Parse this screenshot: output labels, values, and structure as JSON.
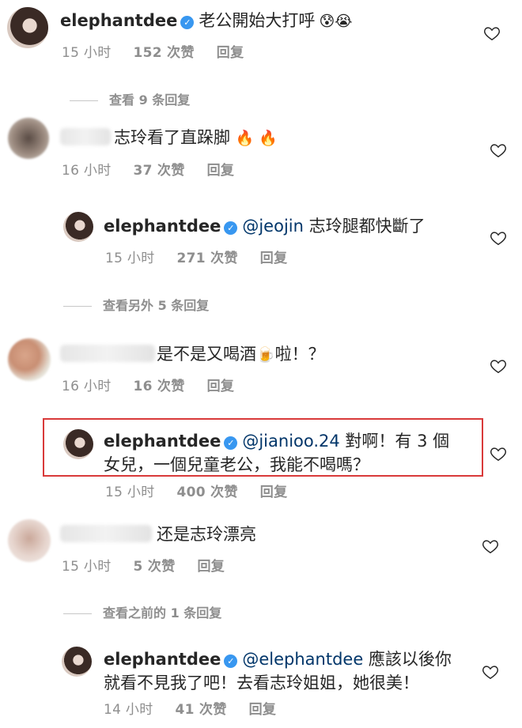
{
  "comments": [
    {
      "username": "elephantdee",
      "text": "老公開始大打呼",
      "emoji": "😰😭",
      "time": "15 小时",
      "likes": "152 次赞",
      "reply": "回复"
    },
    {
      "view_replies": "查看 9 条回复"
    },
    {
      "text": "志玲看了直跺脚",
      "emoji": "🔥 🔥",
      "time": "16 小时",
      "likes": "37 次赞",
      "reply": "回复"
    },
    {
      "username": "elephantdee",
      "mention": "@jeojin",
      "text": " 志玲腿都快斷了",
      "time": "15 小时",
      "likes": "271 次赞",
      "reply": "回复"
    },
    {
      "view_replies": "查看另外 5 条回复"
    },
    {
      "text_a": "是不是又喝酒",
      "emoji": "🍺",
      "text_b": "啦！？",
      "time": "16 小时",
      "likes": "16 次赞",
      "reply": "回复"
    },
    {
      "username": "elephantdee",
      "mention": "@jianioo.24",
      "line1": " 對啊！有 3 個",
      "line2": "女兒，一個兒童老公，我能不喝嗎？",
      "time": "15 小时",
      "likes": "400 次赞",
      "reply": "回复"
    },
    {
      "text": "还是志玲漂亮",
      "time": "15 小时",
      "likes": "5 次赞",
      "reply": "回复"
    },
    {
      "view_replies": "查看之前的 1 条回复"
    },
    {
      "username": "elephantdee",
      "mention": "@elephantdee",
      "line1": " 應該以後你",
      "line2": "就看不見我了吧！去看志玲姐姐，她很美！",
      "time": "14 小时",
      "likes": "41 次赞",
      "reply": "回复"
    }
  ],
  "verified_glyph": "✓",
  "heart_icon": "heart-outline-icon",
  "colors": {
    "verified": "#3897f0",
    "mention": "#003569",
    "meta": "#8e8e8e",
    "highlight": "#d93a3a"
  }
}
